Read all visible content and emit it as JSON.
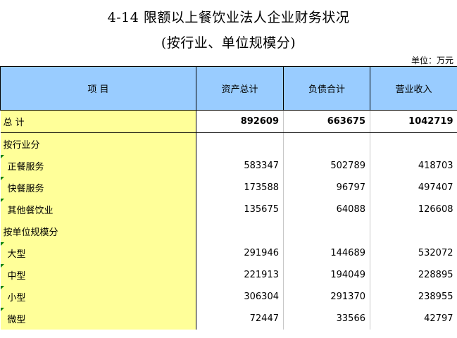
{
  "title": "4-14  限额以上餐饮业法人企业财务状况",
  "subtitle": "(按行业、单位规模分)",
  "unit": "单位：万元",
  "headers": {
    "item": "项 目",
    "assets": "资产总计",
    "liabilities": "负债合计",
    "revenue": "营业收入"
  },
  "rows": [
    {
      "label": "总 计",
      "assets": "892609",
      "liabilities": "663675",
      "revenue": "1042719"
    },
    {
      "label": "按行业分",
      "assets": "",
      "liabilities": "",
      "revenue": ""
    },
    {
      "label": "正餐服务",
      "assets": "583347",
      "liabilities": "502789",
      "revenue": "418703"
    },
    {
      "label": "快餐服务",
      "assets": "173588",
      "liabilities": "96797",
      "revenue": "497407"
    },
    {
      "label": "其他餐饮业",
      "assets": "135675",
      "liabilities": "64088",
      "revenue": "126608"
    },
    {
      "label": "按单位规模分",
      "assets": "",
      "liabilities": "",
      "revenue": ""
    },
    {
      "label": "大型",
      "assets": "291946",
      "liabilities": "144689",
      "revenue": "532072"
    },
    {
      "label": "中型",
      "assets": "221913",
      "liabilities": "194049",
      "revenue": "228895"
    },
    {
      "label": "小型",
      "assets": "306304",
      "liabilities": "291370",
      "revenue": "238955"
    },
    {
      "label": "微型",
      "assets": "72447",
      "liabilities": "33566",
      "revenue": "42797"
    }
  ],
  "colors": {
    "header_bg": "#99ccff",
    "label_bg": "#ffff99",
    "indicator": "#008000"
  }
}
